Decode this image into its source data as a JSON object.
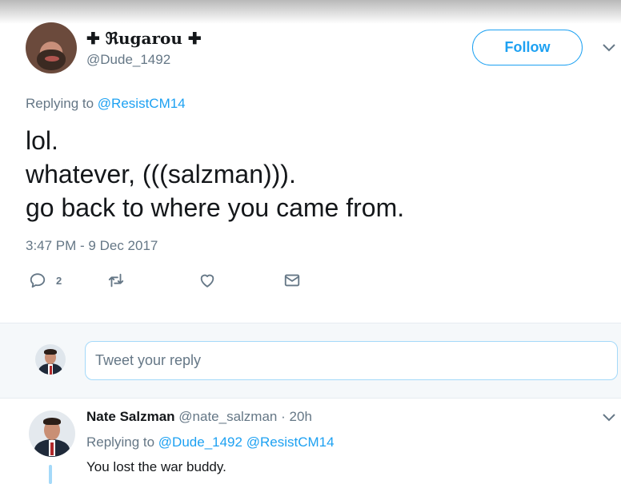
{
  "tweet": {
    "display_name": "✚ ℜugarou ✚",
    "handle": "@Dude_1492",
    "follow_label": "Follow",
    "replying_prefix": "Replying to",
    "replying_to": "@ResistCM14",
    "text_lines": [
      "lol.",
      "whatever, (((salzman))).",
      "go back to where you came from."
    ],
    "timestamp": "3:47 PM - 9 Dec 2017",
    "reply_count": "2",
    "icons": [
      "reply-icon",
      "retweet-icon",
      "like-icon",
      "message-icon",
      "chevron-down-icon"
    ]
  },
  "compose": {
    "placeholder": "Tweet your reply"
  },
  "reply": {
    "name": "Nate Salzman",
    "handle": "@nate_salzman",
    "separator": "·",
    "time": "20h",
    "replying_prefix": "Replying to",
    "replying_to_1": "@Dude_1492",
    "replying_to_2": "@ResistCM14",
    "text": "You lost the war buddy."
  },
  "colors": {
    "accent": "#1da1f2",
    "secondary_text": "#657786",
    "primary_text": "#14171a",
    "band_background": "#f5f8fa"
  }
}
